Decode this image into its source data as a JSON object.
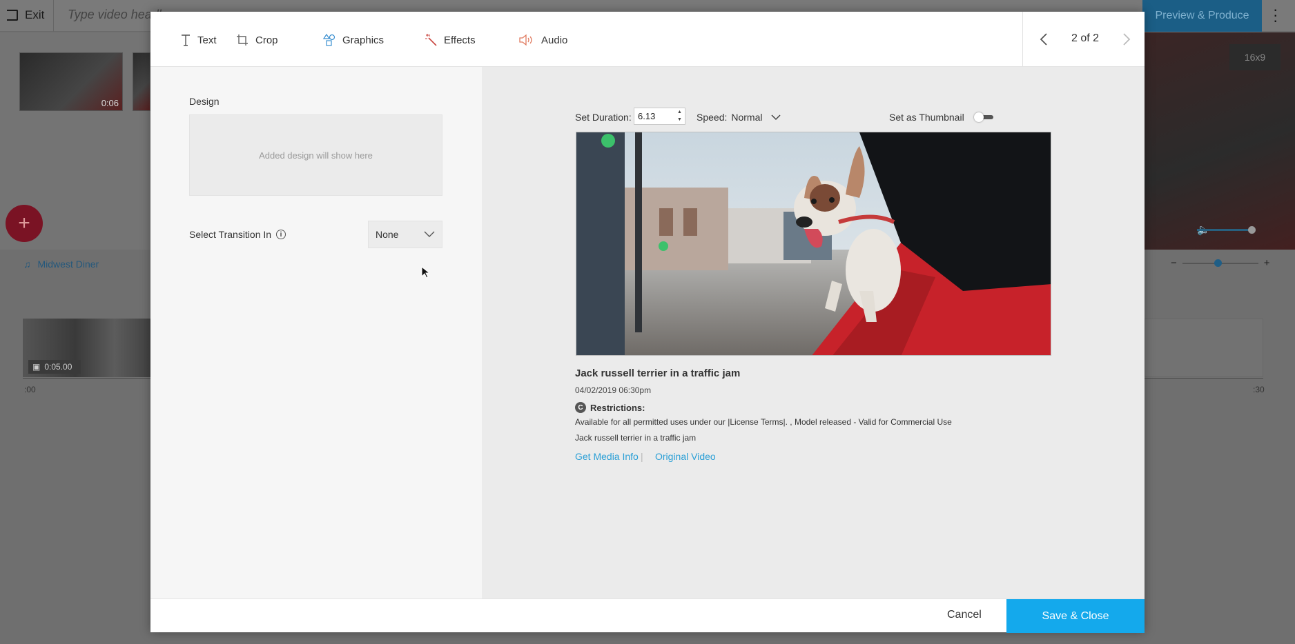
{
  "background": {
    "exit_label": "Exit",
    "headline_placeholder": "Type video headl",
    "preview_produce_label": "Preview & Produce",
    "clip_duration": "0:06",
    "ratio_label": "16x9",
    "music_label": "Midwest Diner",
    "track_duration": "0:05.00",
    "ruler_start": ":00",
    "ruler_end": ":30",
    "zoom_minus": "−",
    "zoom_plus": "+"
  },
  "tabs": [
    {
      "label": "Text",
      "icon": "text-icon"
    },
    {
      "label": "Crop",
      "icon": "crop-icon"
    },
    {
      "label": "Graphics",
      "icon": "graphics-icon"
    },
    {
      "label": "Effects",
      "icon": "effects-wand-icon"
    },
    {
      "label": "Audio",
      "icon": "speaker-icon"
    }
  ],
  "pager": {
    "label": "2 of 2"
  },
  "left_panel": {
    "design_label": "Design",
    "design_placeholder": "Added design will show here",
    "transition_label": "Select Transition In",
    "transition_value": "None"
  },
  "controls": {
    "duration_label": "Set Duration:",
    "duration_value": "6.13",
    "speed_label": "Speed:",
    "speed_value": "Normal",
    "thumbnail_label": "Set as Thumbnail"
  },
  "media": {
    "title": "Jack russell terrier in a traffic jam",
    "date": "04/02/2019 06:30pm",
    "restrictions_label": "Restrictions:",
    "restrictions_text": "Available for all permitted uses under our |License Terms|. , Model released - Valid for Commercial Use",
    "description": "Jack russell terrier in a traffic jam",
    "link_media_info": "Get Media Info",
    "link_separator": "|",
    "link_original": "Original Video"
  },
  "footer": {
    "cancel_label": "Cancel",
    "save_label": "Save & Close"
  },
  "colors": {
    "accent": "#14a9ec",
    "link": "#2a9fd6",
    "effects_icon": "#d9534f",
    "audio_icon": "#e07a5f",
    "graphics_icon": "#3a8fd0"
  }
}
